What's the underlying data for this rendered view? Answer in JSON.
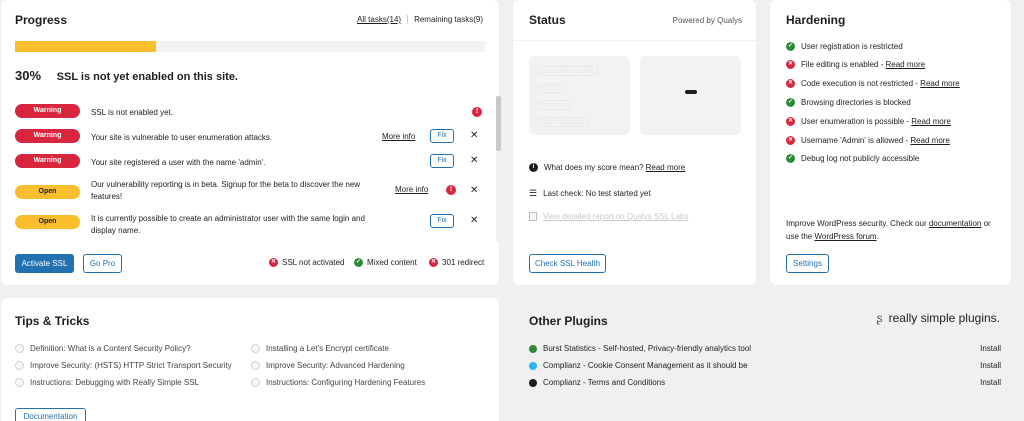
{
  "progress": {
    "title": "Progress",
    "all_tasks": "All tasks(14)",
    "remaining_tasks": "Remaining tasks(9)",
    "percent_value": 30,
    "percent": "30%",
    "message": "SSL is not yet enabled on this site.",
    "tasks": [
      {
        "status": "Warning",
        "text": "SSL is not enabled yet."
      },
      {
        "status": "Warning",
        "text": "Your site is vulnerable to user enumeration attacks.",
        "more_info": "More info",
        "fix": "Fix"
      },
      {
        "status": "Warning",
        "text": "Your site registered a user with the name 'admin'.",
        "fix": "Fix"
      },
      {
        "status": "Open",
        "text": "Our vulnerability reporting is in beta. Signup for the beta to discover the new features!",
        "more_info": "More info"
      },
      {
        "status": "Open",
        "text": "It is currently possible to create an administrator user with the same login and display name.",
        "fix": "Fix"
      }
    ],
    "alert_symbol": "!",
    "close_symbol": "✕",
    "activate_ssl": "Activate SSL",
    "go_pro": "Go Pro",
    "indicators": [
      {
        "state": "error",
        "label": "SSL not activated"
      },
      {
        "state": "ok",
        "label": "Mixed content"
      },
      {
        "state": "error",
        "label": "301 redirect"
      }
    ],
    "colors": {
      "warning": "#d7263d",
      "open": "#f8be2e",
      "primary": "#2271b1"
    }
  },
  "status": {
    "title": "Status",
    "powered_by": "Powered by Qualys",
    "score_question": "What does my score mean?",
    "read_more": "Read more",
    "last_check": "Last check: No test started yet",
    "view_report": "View detailed report on Qualys SSL Labs",
    "check_button": "Check SSL Health",
    "placeholder_rows": [
      "Supported cipher",
      "HSTS",
      "Protocol",
      "Key exchange"
    ],
    "grade": "-"
  },
  "hardening": {
    "title": "Hardening",
    "items": [
      {
        "state": "ok",
        "text": "User registration is restricted"
      },
      {
        "state": "error",
        "text": "File editing is enabled - ",
        "link": "Read more"
      },
      {
        "state": "error",
        "text": "Code execution is not restricted - ",
        "link": "Read more"
      },
      {
        "state": "ok",
        "text": "Browsing directories is blocked"
      },
      {
        "state": "error",
        "text": "User enumeration is possible - ",
        "link": "Read more"
      },
      {
        "state": "error",
        "text": "Username 'Admin' is allowed - ",
        "link": "Read more"
      },
      {
        "state": "ok",
        "text": "Debug log not publicly accessible"
      }
    ],
    "footer_prefix": "Improve WordPress security. Check our ",
    "footer_doc_link": "documentation",
    "footer_mid": " or use the ",
    "footer_forum_link": "WordPress forum",
    "footer_suffix": ".",
    "settings_button": "Settings"
  },
  "tips": {
    "title": "Tips & Tricks",
    "items": [
      "Definition: What is a Content Security Policy?",
      "Installing a Let's Encrypt certificate",
      "Improve Security: (HSTS) HTTP Strict Transport Security",
      "Improve Security: Advanced Hardening",
      "Instructions: Debugging with Really Simple SSL",
      "Instructions: Configuring Hardening Features"
    ],
    "documentation_button": "Documentation"
  },
  "plugins": {
    "title": "Other Plugins",
    "brand": "really simple plugins.",
    "items": [
      {
        "name": "Burst Statistics - Self-hosted, Privacy-friendly analytics tool",
        "action": "Install",
        "color": "#2e8a37"
      },
      {
        "name": "Complianz - Cookie Consent Management as it should be",
        "action": "Install",
        "color": "#29b6f6"
      },
      {
        "name": "Complianz - Terms and Conditions",
        "action": "Install",
        "color": "#1e1e1e"
      }
    ]
  }
}
